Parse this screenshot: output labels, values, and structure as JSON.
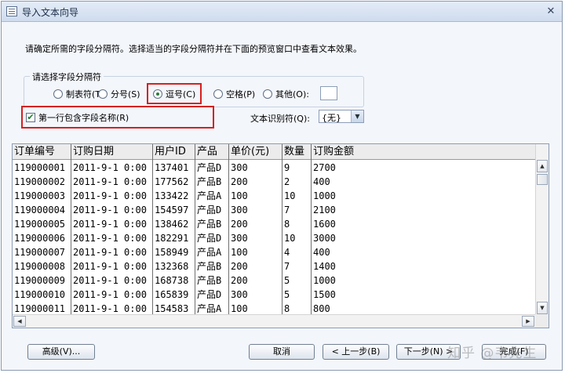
{
  "window": {
    "title": "导入文本向导",
    "icon": "app-icon",
    "close_label": "✕"
  },
  "instruction": "请确定所需的字段分隔符。选择适当的字段分隔符并在下面的预览窗口中查看文本效果。",
  "delimiter_group": {
    "label": "请选择字段分隔符",
    "options": [
      {
        "label": "制表符(T)",
        "selected": false
      },
      {
        "label": "分号(S)",
        "selected": false
      },
      {
        "label": "逗号(C)",
        "selected": true
      },
      {
        "label": "空格(P)",
        "selected": false
      },
      {
        "label": "其他(O):",
        "selected": false
      }
    ],
    "other_value": ""
  },
  "first_row_names": {
    "label": "第一行包含字段名称(R)",
    "checked": true,
    "mark": "✔"
  },
  "text_qualifier": {
    "label": "文本识别符(Q):",
    "value": "{无}"
  },
  "preview": {
    "columns": [
      "订单编号",
      "订购日期",
      "用户ID",
      "产品",
      "单价(元)",
      "数量",
      "订购金额"
    ],
    "rows": [
      [
        "119000001",
        "2011-9-1 0:00",
        "137401",
        "产品D",
        "300",
        "9",
        "2700"
      ],
      [
        "119000002",
        "2011-9-1 0:00",
        "177562",
        "产品B",
        "200",
        "2",
        "400"
      ],
      [
        "119000003",
        "2011-9-1 0:00",
        "133422",
        "产品A",
        "100",
        "10",
        "1000"
      ],
      [
        "119000004",
        "2011-9-1 0:00",
        "154597",
        "产品D",
        "300",
        "7",
        "2100"
      ],
      [
        "119000005",
        "2011-9-1 0:00",
        "138462",
        "产品B",
        "200",
        "8",
        "1600"
      ],
      [
        "119000006",
        "2011-9-1 0:00",
        "182291",
        "产品D",
        "300",
        "10",
        "3000"
      ],
      [
        "119000007",
        "2011-9-1 0:00",
        "158949",
        "产品A",
        "100",
        "4",
        "400"
      ],
      [
        "119000008",
        "2011-9-1 0:00",
        "132368",
        "产品B",
        "200",
        "7",
        "1400"
      ],
      [
        "119000009",
        "2011-9-1 0:00",
        "168738",
        "产品B",
        "200",
        "5",
        "1000"
      ],
      [
        "119000010",
        "2011-9-1 0:00",
        "165839",
        "产品D",
        "300",
        "5",
        "1500"
      ],
      [
        "119000011",
        "2011-9-1 0:00",
        "154583",
        "产品A",
        "100",
        "8",
        "800"
      ]
    ]
  },
  "buttons": {
    "advanced": "高级(V)...",
    "cancel": "取消",
    "back": "< 上一步(B)",
    "next": "下一步(N) >",
    "finish": "完成(F)"
  },
  "watermark": "知乎 @韦先生",
  "colors": {
    "highlight_red": "#d62020",
    "title_gradient_top": "#e3ecf8",
    "dialog_bg": "#f3f6fb"
  }
}
